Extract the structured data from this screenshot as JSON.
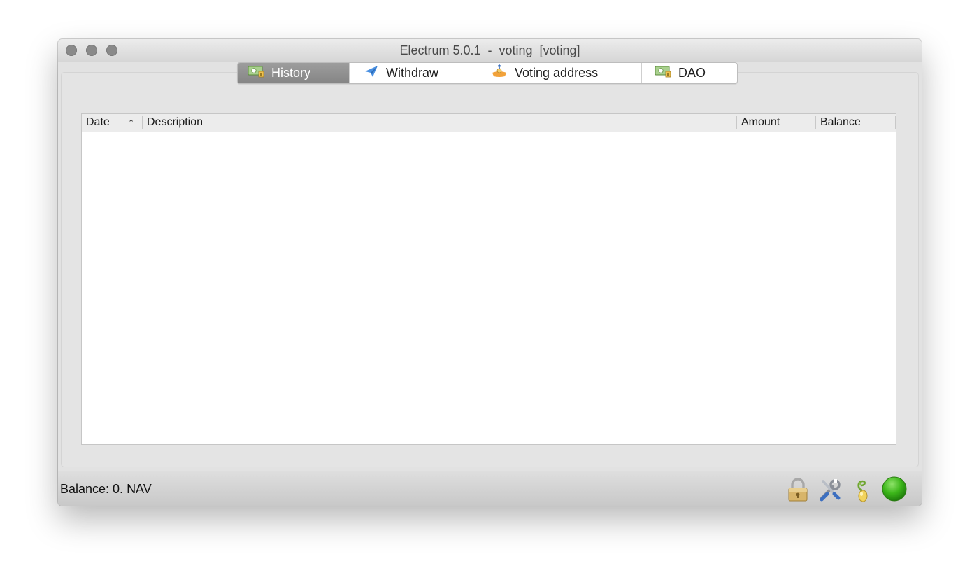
{
  "window": {
    "title": "Electrum 5.0.1  -  voting  [voting]"
  },
  "tabs": [
    {
      "label": "History",
      "icon": "wallet-icon",
      "active": true
    },
    {
      "label": "Withdraw",
      "icon": "paper-plane-icon",
      "active": false
    },
    {
      "label": "Voting address",
      "icon": "receive-icon",
      "active": false
    },
    {
      "label": "DAO",
      "icon": "wallet-icon",
      "active": false
    }
  ],
  "history_table": {
    "columns": [
      "Date",
      "Description",
      "Amount",
      "Balance"
    ],
    "sort_column": "Date",
    "sort_direction": "ascending",
    "rows": []
  },
  "statusbar": {
    "balance_text": "Balance: 0. NAV",
    "icons": [
      "lock-icon",
      "tools-icon",
      "seed-icon",
      "network-status-icon"
    ],
    "colors": {
      "network_status": "#3cb61a",
      "lock": "#d8b56a"
    }
  }
}
